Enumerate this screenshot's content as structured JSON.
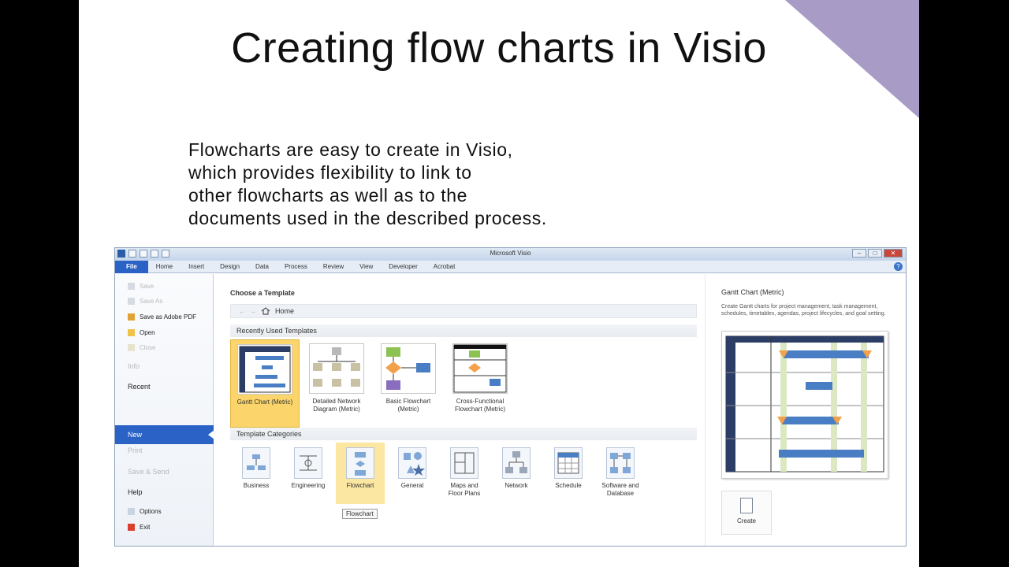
{
  "slide": {
    "title": "Creating flow charts in Visio",
    "body_lines": [
      "Flowcharts are easy to create in Visio,",
      "which provides flexibility to link to",
      "other flowcharts as well as to the",
      "documents used in the described process."
    ],
    "corner_color": "#a89bc6"
  },
  "app": {
    "title": "Microsoft Visio",
    "window_controls": [
      "–",
      "□",
      "✕"
    ],
    "ribbon": {
      "file": "File",
      "tabs": [
        "Home",
        "Insert",
        "Design",
        "Data",
        "Process",
        "Review",
        "View",
        "Developer",
        "Acrobat"
      ],
      "help": "?"
    }
  },
  "backstage": {
    "items": {
      "save": "Save",
      "save_as": "Save As",
      "save_pdf": "Save as Adobe PDF",
      "open": "Open",
      "close": "Close",
      "info": "Info",
      "recent": "Recent",
      "new": "New",
      "print": "Print",
      "save_send": "Save & Send",
      "help": "Help",
      "options": "Options",
      "exit": "Exit"
    }
  },
  "center": {
    "heading": "Choose a Template",
    "nav": {
      "back": "←",
      "forward": "→",
      "home": "Home"
    },
    "recent_header": "Recently Used Templates",
    "recent_templates": [
      {
        "label_1": "Gantt Chart (Metric)",
        "label_2": "",
        "selected": true
      },
      {
        "label_1": "Detailed Network",
        "label_2": "Diagram (Metric)",
        "selected": false
      },
      {
        "label_1": "Basic Flowchart",
        "label_2": "(Metric)",
        "selected": false
      },
      {
        "label_1": "Cross-Functional",
        "label_2": "Flowchart (Metric)",
        "selected": false
      }
    ],
    "categories_header": "Template Categories",
    "categories": [
      {
        "label_1": "Business",
        "label_2": ""
      },
      {
        "label_1": "Engineering",
        "label_2": ""
      },
      {
        "label_1": "Flowchart",
        "label_2": ""
      },
      {
        "label_1": "General",
        "label_2": ""
      },
      {
        "label_1": "Maps and",
        "label_2": "Floor Plans"
      },
      {
        "label_1": "Network",
        "label_2": ""
      },
      {
        "label_1": "Schedule",
        "label_2": ""
      },
      {
        "label_1": "Software and",
        "label_2": "Database"
      }
    ],
    "tooltip": "Flowchart"
  },
  "preview_pane": {
    "title": "Gantt Chart (Metric)",
    "description": "Create Gantt charts for project management, task management, schedules, timetables, agendas, project lifecycles, and goal setting.",
    "create_label": "Create"
  },
  "colors": {
    "accent": "#2a62c6",
    "selection": "#fbd56b"
  }
}
